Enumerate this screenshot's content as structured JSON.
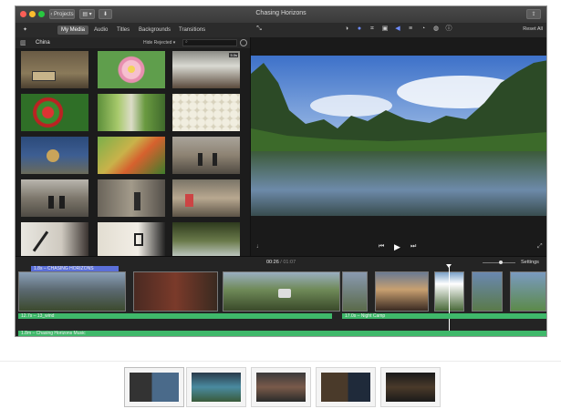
{
  "window": {
    "title": "Chasing Horizons",
    "projects_button": "Projects",
    "accent": "#6e8cff"
  },
  "browser": {
    "tabs": [
      {
        "label": "My Media"
      },
      {
        "label": "Audio"
      },
      {
        "label": "Titles"
      },
      {
        "label": "Backgrounds"
      },
      {
        "label": "Transitions"
      }
    ],
    "library_name": "China",
    "filter_label": "Hide Rejected",
    "filter_badge": "5.0s"
  },
  "viewer": {
    "reset_all": "Reset All",
    "time_current": "00:26",
    "time_separator": "/",
    "time_total": "01:07"
  },
  "timeline": {
    "title_clip": "1.8s – CHASING HORIZONS",
    "settings_label": "Settings",
    "audio_clip_1": "12.7s – 13_wind",
    "audio_clip_2": "17.0s – Night Camp",
    "music_clip": "1.8m – Chasing Horizons Music",
    "audio_color": "#3fb86a",
    "title_color": "#5b6fd8"
  },
  "icons": {
    "back": "chevron-left-icon",
    "share": "share-icon",
    "play": "play-icon",
    "prev": "skip-back-icon",
    "next": "skip-forward-icon",
    "fullscreen": "expand-icon"
  }
}
